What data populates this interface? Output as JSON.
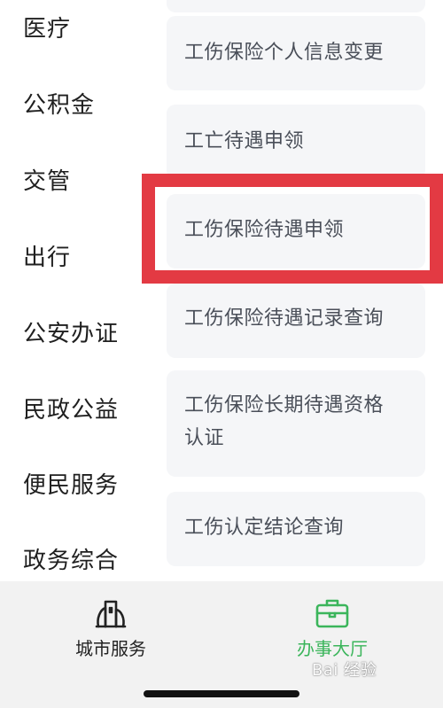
{
  "sidebar": {
    "items": [
      {
        "label": "医疗"
      },
      {
        "label": "公积金"
      },
      {
        "label": "交管"
      },
      {
        "label": "出行"
      },
      {
        "label": "公安办证"
      },
      {
        "label": "民政公益"
      },
      {
        "label": "便民服务"
      },
      {
        "label": "政务综合"
      }
    ]
  },
  "services": {
    "items": [
      {
        "label": "工伤保险个人信息变更"
      },
      {
        "label": "工亡待遇申领"
      },
      {
        "label": "工伤保险待遇申领"
      },
      {
        "label": "工伤保险待遇记录查询"
      },
      {
        "label": "工伤保险长期待遇资格",
        "label_line2": "认证"
      },
      {
        "label": "工伤认定结论查询"
      }
    ],
    "highlighted": "工伤保险待遇申领"
  },
  "tabbar": {
    "tabs": [
      {
        "label": "城市服务",
        "icon": "city-buildings-icon",
        "active": false
      },
      {
        "label": "办事大厅",
        "icon": "briefcase-icon",
        "active": true
      }
    ],
    "active_color": "#3bb55b",
    "inactive_color": "#222222"
  },
  "watermark": {
    "text": "Bai 经验"
  },
  "colors": {
    "highlight": "#e33a43",
    "card_bg": "#f5f6f8"
  }
}
